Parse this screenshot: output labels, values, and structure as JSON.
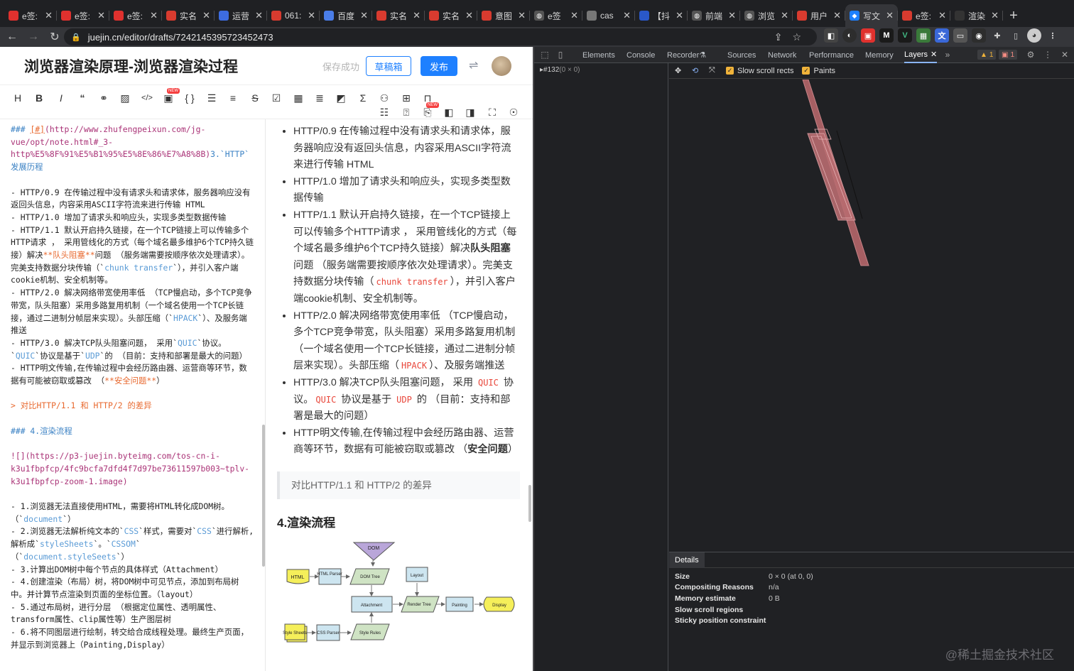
{
  "browser": {
    "tabs": [
      {
        "fav": "dy",
        "color": "#e0312e",
        "label": "e签:"
      },
      {
        "fav": "dy",
        "color": "#e0312e",
        "label": "e签:"
      },
      {
        "fav": "dy",
        "color": "#e0312e",
        "label": "e签:"
      },
      {
        "fav": "csdn",
        "color": "#d83b2f",
        "label": "实名"
      },
      {
        "fav": "doc",
        "color": "#3d6ce0",
        "label": "运营"
      },
      {
        "fav": "csdn",
        "color": "#d83b2f",
        "label": "061:"
      },
      {
        "fav": "tr",
        "color": "#4a7de8",
        "label": "百度"
      },
      {
        "fav": "csdn",
        "color": "#d83b2f",
        "label": "实名"
      },
      {
        "fav": "csdn",
        "color": "#d83b2f",
        "label": "实名"
      },
      {
        "fav": "csdn",
        "color": "#d83b2f",
        "label": "意图"
      },
      {
        "fav": "globe",
        "color": "#555",
        "label": "e签"
      },
      {
        "fav": "img",
        "color": "#777",
        "label": "cas"
      },
      {
        "fav": "b",
        "color": "#2a58c8",
        "label": "【抖"
      },
      {
        "fav": "globe",
        "color": "#555",
        "label": "前端"
      },
      {
        "fav": "globe",
        "color": "#555",
        "label": "浏览"
      },
      {
        "fav": "csdn",
        "color": "#d83b2f",
        "label": "用户"
      },
      {
        "fav": "jj",
        "color": "#1e80ff",
        "label": "写文"
      },
      {
        "fav": "csdn",
        "color": "#d83b2f",
        "label": "e签:"
      },
      {
        "fav": "m",
        "color": "#333",
        "label": "渲染"
      }
    ],
    "active_tab_index": 16,
    "url": "juejin.cn/editor/drafts/7242145395723452473"
  },
  "editor": {
    "title": "浏览器渲染原理-浏览器渲染过程",
    "save_status": "保存成功",
    "draft_button": "草稿箱",
    "publish_button": "发布"
  },
  "markdown": {
    "h_line1": "### [#](http://www.zhufengpeixun.com/jg-vue/opt/note.html#_3-http%E5%8F%91%E5%B1%95%E5%8E%86%E7%A8%8B)3.`HTTP`发展历程",
    "items": [
      "-   HTTP/0.9 在传输过程中没有请求头和请求体，服务器响应没有返回头信息，内容采用ASCII字符流来进行传输 HTML",
      "-   HTTP/1.0 增加了请求头和响应头，实现多类型数据传输",
      "-   HTTP/1.1 默认开启持久链接，在一个TCP链接上可以传输多个HTTP请求 ， 采用管线化的方式（每个域名最多维护6个TCP持久链接）解决**队头阻塞**问题 （服务端需要按顺序依次处理请求）。完美支持数据分块传输（`chunk transfer`），并引入客户端cookie机制、安全机制等。",
      "-   HTTP/2.0 解决网络带宽使用率低 （TCP慢启动，多个TCP竞争带宽，队头阻塞）采用多路复用机制（一个域名使用一个TCP长链接，通过二进制分帧层来实现）。头部压缩（`HPACK`）、及服务端推送",
      "-   HTTP/3.0 解决TCP队头阻塞问题， 采用`QUIC`协议。`QUIC`协议是基于`UDP`的 （目前：支持和部署是最大的问题）",
      "-   HTTP明文传输,在传输过程中会经历路由器、运营商等环节，数据有可能被窃取或篡改 （**安全问题**）"
    ],
    "quote": "> 对比HTTP/1.1 和 HTTP/2 的差异",
    "h4": "### 4.渲染流程",
    "image_line": "![](https://p3-juejin.byteimg.com/tos-cn-i-k3u1fbpfcp/4fc9bcfa7dfd4f7d97be73611597b003~tplv-k3u1fbpfcp-zoom-1.image)",
    "steps": [
      "-   1.浏览器无法直接使用HTML，需要将HTML转化成DOM树。（`document`）",
      "-   2.浏览器无法解析纯文本的`CSS`样式，需要对`CSS`进行解析,解析成`styleSheets`。`CSSOM`（`document.styleSeets`）",
      "-   3.计算出DOM树中每个节点的具体样式（Attachment）",
      "-   4.创建渲染（布局）树，将DOM树中可见节点，添加到布局树中。并计算节点渲染到页面的坐标位置。（layout）",
      "-   5.通过布局树，进行分层 （根据定位属性、透明属性、transform属性、clip属性等）生产图层树",
      "-   6.将不同图层进行绘制，转交给合成线程处理。最终生产页面，并显示到浏览器上（Painting,Display）"
    ]
  },
  "preview": {
    "items": [
      {
        "pre": "HTTP/0.9 在传输过程中没有请求头和请求体，服务器响应没有返回头信息，内容采用ASCII字符流来进行传输 HTML"
      },
      {
        "pre": "HTTP/1.0 增加了请求头和响应头，实现多类型数据传输"
      },
      {
        "pre": "HTTP/1.1 默认开启持久链接，在一个TCP链接上可以传输多个HTTP请求 ， 采用管线化的方式（每个域名最多维护6个TCP持久链接）解决",
        "bold": "队头阻塞",
        "post": "问题 （服务端需要按顺序依次处理请求）。完美支持数据分块传输（",
        "code": "chunk transfer",
        "post2": "），并引入客户端cookie机制、安全机制等。"
      },
      {
        "pre": "HTTP/2.0 解决网络带宽使用率低 （TCP慢启动，多个TCP竞争带宽，队头阻塞）采用多路复用机制（一个域名使用一个TCP长链接，通过二进制分帧层来实现）。头部压缩（",
        "code": "HPACK",
        "post": "）、及服务端推送"
      },
      {
        "pre": "HTTP/3.0 解决TCP队头阻塞问题， 采用 ",
        "code": "QUIC",
        "post": " 协议。",
        "code2": "QUIC",
        "post2": " 协议是基于 ",
        "code3": "UDP",
        "post3": " 的 （目前：支持和部署是最大的问题）"
      },
      {
        "pre": "HTTP明文传输,在传输过程中会经历路由器、运营商等环节，数据有可能被窃取或篡改 （",
        "bold": "安全问题",
        "post": "）"
      }
    ],
    "quote": "对比HTTP/1.1 和 HTTP/2 的差异",
    "h4": "4.渲染流程",
    "diagram_labels": {
      "dom": "DOM",
      "html": "HTML",
      "html_parser": "HTML Parser",
      "dom_tree": "DOM Tree",
      "layout": "Layout",
      "attachment": "Attachment",
      "render_tree": "Render Tree",
      "painting": "Painting",
      "display": "Display",
      "style_sheets": "Style Sheets",
      "css_parser": "CSS Parser",
      "style_rules": "Style Rules"
    }
  },
  "devtools": {
    "tabs": [
      "Elements",
      "Console",
      "Recorder",
      "Sources",
      "Network",
      "Performance",
      "Memory",
      "Layers"
    ],
    "active_tab": "Layers",
    "warnings": "1",
    "errors": "1",
    "layer_tree_item": "#132",
    "layer_tree_size": "(0 × 0)",
    "toolbar_checks": [
      "Slow scroll rects",
      "Paints"
    ],
    "details_tab": "Details",
    "details": [
      {
        "k": "Size",
        "v": "0 × 0 (at 0, 0)"
      },
      {
        "k": "Compositing Reasons",
        "v": "n/a"
      },
      {
        "k": "Memory estimate",
        "v": "0 B"
      },
      {
        "k": "Slow scroll regions",
        "v": ""
      },
      {
        "k": "Sticky position constraint",
        "v": ""
      }
    ],
    "colors": {
      "layer_fill": "#b5666a",
      "layer_stroke": "#d98e92",
      "accent": "#8ab4f8"
    }
  },
  "watermark": "@稀土掘金技术社区"
}
